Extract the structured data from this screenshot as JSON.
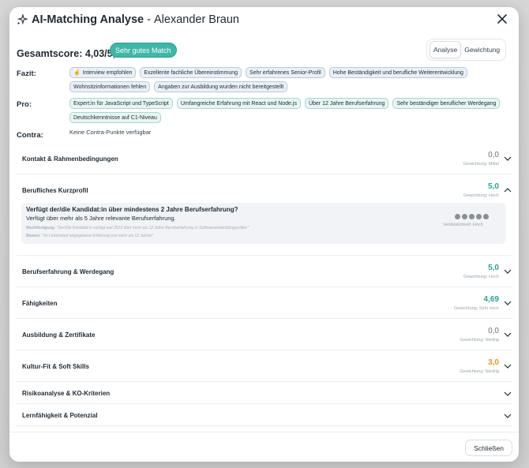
{
  "modal": {
    "title": "AI-Matching Analyse",
    "separator": "-",
    "candidate_name": "Alexander Braun"
  },
  "score": {
    "label": "Gesamtscore: 4,03/5,0",
    "badge": "Sehr gutes Match"
  },
  "tabs": [
    {
      "label": "Analyse",
      "active": true
    },
    {
      "label": "Gewichtung",
      "active": false
    }
  ],
  "fazit": {
    "label": "Fazit:",
    "chips": [
      "Interview empfohlen",
      "Exzellente fachliche Übereinstimmung",
      "Sehr erfahrenes Senior-Profil",
      "Hohe Beständigkeit und berufliche Weiterentwicklung",
      "Wohnsitzinformationen fehlen",
      "Angaben zur Ausbildung wurden nicht bereitgestellt"
    ]
  },
  "pro": {
    "label": "Pro:",
    "chips": [
      "Expert:in für JavaScript und TypeScript",
      "Umfangreiche Erfahrung mit React und Node.js",
      "Über 12 Jahre Berufserfahrung",
      "Sehr beständiger beruflicher Werdegang",
      "Deutschkenntnisse auf C1-Niveau"
    ]
  },
  "contra": {
    "label": "Contra:",
    "text": "Keine Contra-Punkte verfügbar"
  },
  "sections": [
    {
      "name": "Kontakt & Rahmenbedingungen",
      "value": "0,0",
      "weight": "Gewichtung: Mittel",
      "color": "#6b7280"
    },
    {
      "name": "Berufliches Kurzprofil",
      "value": "5,0",
      "weight": "Gewichtung: Hoch",
      "color": "#2aa091"
    },
    {
      "name": "Berufserfahrung & Werdegang",
      "value": "5,0",
      "weight": "Gewichtung: Hoch",
      "color": "#2aa091"
    },
    {
      "name": "Fähigkeiten",
      "value": "4,69",
      "weight": "Gewichtung: Sehr hoch",
      "color": "#2aa091"
    },
    {
      "name": "Ausbildung & Zertifikate",
      "value": "0,0",
      "weight": "Gewichtung: Niedrig",
      "color": "#6b7280"
    },
    {
      "name": "Kultur-Fit & Soft Skills",
      "value": "3,0",
      "weight": "Gewichtung: Niedrig",
      "color": "#e8942b"
    },
    {
      "name": "Risikoanalyse & KO-Kriterien",
      "value": "",
      "weight": ""
    },
    {
      "name": "Lernfähigkeit & Potenzial",
      "value": "",
      "weight": ""
    }
  ],
  "detail": {
    "question": "Verfügt der/die Kandidat:in über mindestens 2 Jahre Berufserfahrung?",
    "answer": "Verfügt über mehr als 5 Jahre relevante Berufserfahrung.",
    "justification_label": "Rechtfertigung:",
    "justification": "\"Der/Die Kandidat:in verfügt seit 2012 über mehr als 12 Jahre Berufserfahrung in Softwareentwicklungsrollen.\"",
    "evidence_label": "Beweis:",
    "evidence": "\"Im Lebenslauf angegebene Erfahrung von mehr als 12 Jahren\"",
    "confidence_dots": 5,
    "confidence": "Verlässlichkeit: Hoch"
  },
  "footer": {
    "close_label": "Schließen"
  },
  "icons": {
    "sparkle": "sparkle-icon",
    "close": "close-icon",
    "chevron_down": "chevron-down-icon",
    "chevron_up": "chevron-up-icon",
    "thumb": "thumbs-up-icon"
  },
  "colors": {
    "accent": "#3fb6a8",
    "score_high": "#2aa091",
    "score_mid": "#e8942b",
    "score_none": "#6b7280"
  }
}
